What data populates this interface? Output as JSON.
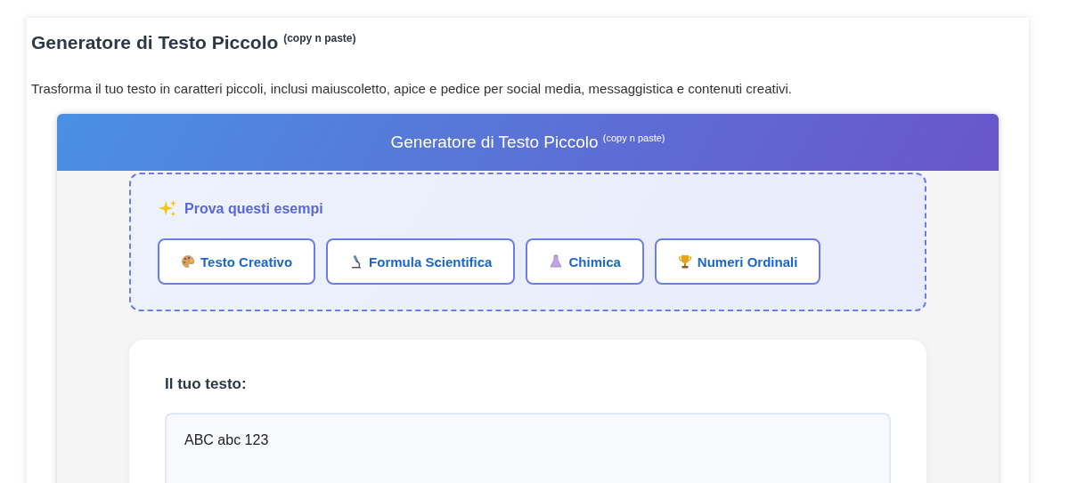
{
  "page": {
    "title": "Generatore di Testo Piccolo $^{(copy n paste)}$",
    "intro": "Trasforma il tuo testo in caratteri piccoli, inclusi maiuscoletto, apice e pedice per social media, messaggistica e contenuti creativi."
  },
  "tool": {
    "header": "Generatore di Testo Piccolo $^{(copy n paste)}$",
    "examples": {
      "heading": "Prova questi esempi",
      "buttons": [
        {
          "label": "Testo Creativo",
          "kind": "palette"
        },
        {
          "label": "Formula Scientifica",
          "kind": "microscope"
        },
        {
          "label": "Chimica",
          "kind": "flask"
        },
        {
          "label": "Numeri Ordinali",
          "kind": "trophy"
        }
      ]
    },
    "input": {
      "label": "Il tuo testo:",
      "value": "ABC abc 123"
    }
  }
}
